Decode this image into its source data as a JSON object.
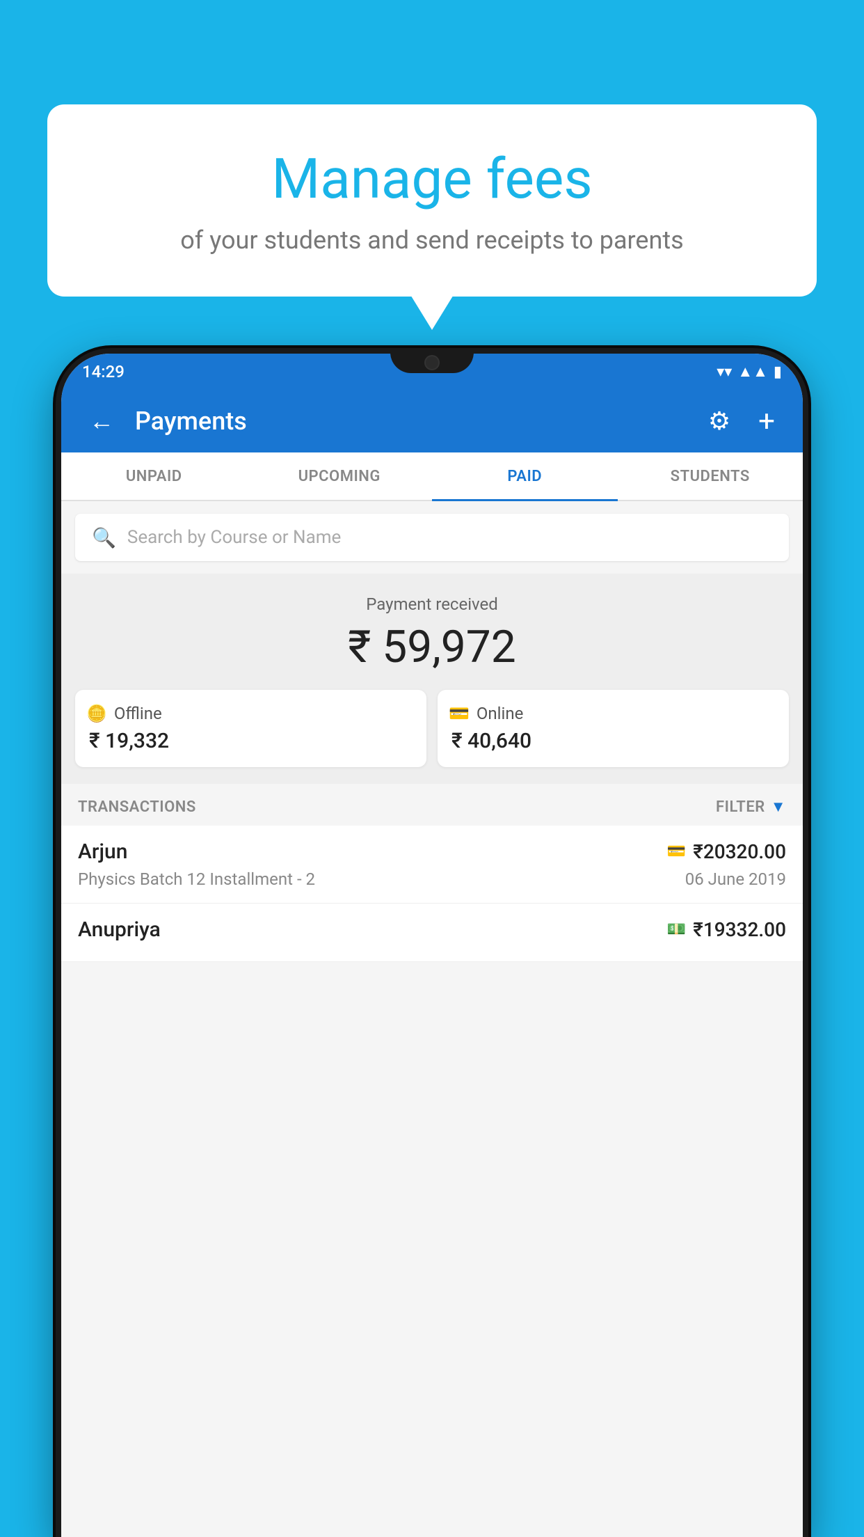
{
  "background_color": "#1AB4E8",
  "bubble": {
    "title": "Manage fees",
    "subtitle": "of your students and send receipts to parents"
  },
  "status_bar": {
    "time": "14:29",
    "wifi_icon": "▾",
    "signal_icon": "▾",
    "battery_icon": "▪"
  },
  "app_bar": {
    "title": "Payments",
    "back_label": "←",
    "gear_label": "⚙",
    "plus_label": "+"
  },
  "tabs": [
    {
      "label": "UNPAID",
      "active": false
    },
    {
      "label": "UPCOMING",
      "active": false
    },
    {
      "label": "PAID",
      "active": true
    },
    {
      "label": "STUDENTS",
      "active": false
    }
  ],
  "search": {
    "placeholder": "Search by Course or Name"
  },
  "payment_summary": {
    "label": "Payment received",
    "total": "₹ 59,972",
    "offline_label": "Offline",
    "offline_amount": "₹ 19,332",
    "online_label": "Online",
    "online_amount": "₹ 40,640"
  },
  "transactions_section": {
    "label": "TRANSACTIONS",
    "filter_label": "FILTER"
  },
  "transactions": [
    {
      "name": "Arjun",
      "amount": "₹20320.00",
      "type_icon": "💳",
      "course": "Physics Batch 12 Installment - 2",
      "date": "06 June 2019"
    },
    {
      "name": "Anupriya",
      "amount": "₹19332.00",
      "type_icon": "💵",
      "course": "",
      "date": ""
    }
  ]
}
